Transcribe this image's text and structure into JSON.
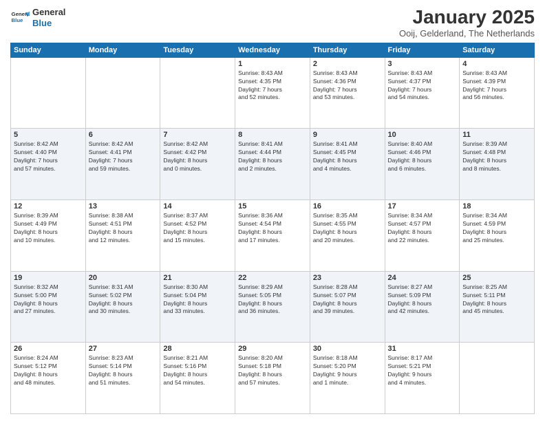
{
  "logo": {
    "line1": "General",
    "line2": "Blue"
  },
  "title": "January 2025",
  "subtitle": "Ooij, Gelderland, The Netherlands",
  "days_header": [
    "Sunday",
    "Monday",
    "Tuesday",
    "Wednesday",
    "Thursday",
    "Friday",
    "Saturday"
  ],
  "weeks": [
    [
      {
        "day": "",
        "info": ""
      },
      {
        "day": "",
        "info": ""
      },
      {
        "day": "",
        "info": ""
      },
      {
        "day": "1",
        "info": "Sunrise: 8:43 AM\nSunset: 4:35 PM\nDaylight: 7 hours\nand 52 minutes."
      },
      {
        "day": "2",
        "info": "Sunrise: 8:43 AM\nSunset: 4:36 PM\nDaylight: 7 hours\nand 53 minutes."
      },
      {
        "day": "3",
        "info": "Sunrise: 8:43 AM\nSunset: 4:37 PM\nDaylight: 7 hours\nand 54 minutes."
      },
      {
        "day": "4",
        "info": "Sunrise: 8:43 AM\nSunset: 4:39 PM\nDaylight: 7 hours\nand 56 minutes."
      }
    ],
    [
      {
        "day": "5",
        "info": "Sunrise: 8:42 AM\nSunset: 4:40 PM\nDaylight: 7 hours\nand 57 minutes."
      },
      {
        "day": "6",
        "info": "Sunrise: 8:42 AM\nSunset: 4:41 PM\nDaylight: 7 hours\nand 59 minutes."
      },
      {
        "day": "7",
        "info": "Sunrise: 8:42 AM\nSunset: 4:42 PM\nDaylight: 8 hours\nand 0 minutes."
      },
      {
        "day": "8",
        "info": "Sunrise: 8:41 AM\nSunset: 4:44 PM\nDaylight: 8 hours\nand 2 minutes."
      },
      {
        "day": "9",
        "info": "Sunrise: 8:41 AM\nSunset: 4:45 PM\nDaylight: 8 hours\nand 4 minutes."
      },
      {
        "day": "10",
        "info": "Sunrise: 8:40 AM\nSunset: 4:46 PM\nDaylight: 8 hours\nand 6 minutes."
      },
      {
        "day": "11",
        "info": "Sunrise: 8:39 AM\nSunset: 4:48 PM\nDaylight: 8 hours\nand 8 minutes."
      }
    ],
    [
      {
        "day": "12",
        "info": "Sunrise: 8:39 AM\nSunset: 4:49 PM\nDaylight: 8 hours\nand 10 minutes."
      },
      {
        "day": "13",
        "info": "Sunrise: 8:38 AM\nSunset: 4:51 PM\nDaylight: 8 hours\nand 12 minutes."
      },
      {
        "day": "14",
        "info": "Sunrise: 8:37 AM\nSunset: 4:52 PM\nDaylight: 8 hours\nand 15 minutes."
      },
      {
        "day": "15",
        "info": "Sunrise: 8:36 AM\nSunset: 4:54 PM\nDaylight: 8 hours\nand 17 minutes."
      },
      {
        "day": "16",
        "info": "Sunrise: 8:35 AM\nSunset: 4:55 PM\nDaylight: 8 hours\nand 20 minutes."
      },
      {
        "day": "17",
        "info": "Sunrise: 8:34 AM\nSunset: 4:57 PM\nDaylight: 8 hours\nand 22 minutes."
      },
      {
        "day": "18",
        "info": "Sunrise: 8:34 AM\nSunset: 4:59 PM\nDaylight: 8 hours\nand 25 minutes."
      }
    ],
    [
      {
        "day": "19",
        "info": "Sunrise: 8:32 AM\nSunset: 5:00 PM\nDaylight: 8 hours\nand 27 minutes."
      },
      {
        "day": "20",
        "info": "Sunrise: 8:31 AM\nSunset: 5:02 PM\nDaylight: 8 hours\nand 30 minutes."
      },
      {
        "day": "21",
        "info": "Sunrise: 8:30 AM\nSunset: 5:04 PM\nDaylight: 8 hours\nand 33 minutes."
      },
      {
        "day": "22",
        "info": "Sunrise: 8:29 AM\nSunset: 5:05 PM\nDaylight: 8 hours\nand 36 minutes."
      },
      {
        "day": "23",
        "info": "Sunrise: 8:28 AM\nSunset: 5:07 PM\nDaylight: 8 hours\nand 39 minutes."
      },
      {
        "day": "24",
        "info": "Sunrise: 8:27 AM\nSunset: 5:09 PM\nDaylight: 8 hours\nand 42 minutes."
      },
      {
        "day": "25",
        "info": "Sunrise: 8:25 AM\nSunset: 5:11 PM\nDaylight: 8 hours\nand 45 minutes."
      }
    ],
    [
      {
        "day": "26",
        "info": "Sunrise: 8:24 AM\nSunset: 5:12 PM\nDaylight: 8 hours\nand 48 minutes."
      },
      {
        "day": "27",
        "info": "Sunrise: 8:23 AM\nSunset: 5:14 PM\nDaylight: 8 hours\nand 51 minutes."
      },
      {
        "day": "28",
        "info": "Sunrise: 8:21 AM\nSunset: 5:16 PM\nDaylight: 8 hours\nand 54 minutes."
      },
      {
        "day": "29",
        "info": "Sunrise: 8:20 AM\nSunset: 5:18 PM\nDaylight: 8 hours\nand 57 minutes."
      },
      {
        "day": "30",
        "info": "Sunrise: 8:18 AM\nSunset: 5:20 PM\nDaylight: 9 hours\nand 1 minute."
      },
      {
        "day": "31",
        "info": "Sunrise: 8:17 AM\nSunset: 5:21 PM\nDaylight: 9 hours\nand 4 minutes."
      },
      {
        "day": "",
        "info": ""
      }
    ]
  ]
}
